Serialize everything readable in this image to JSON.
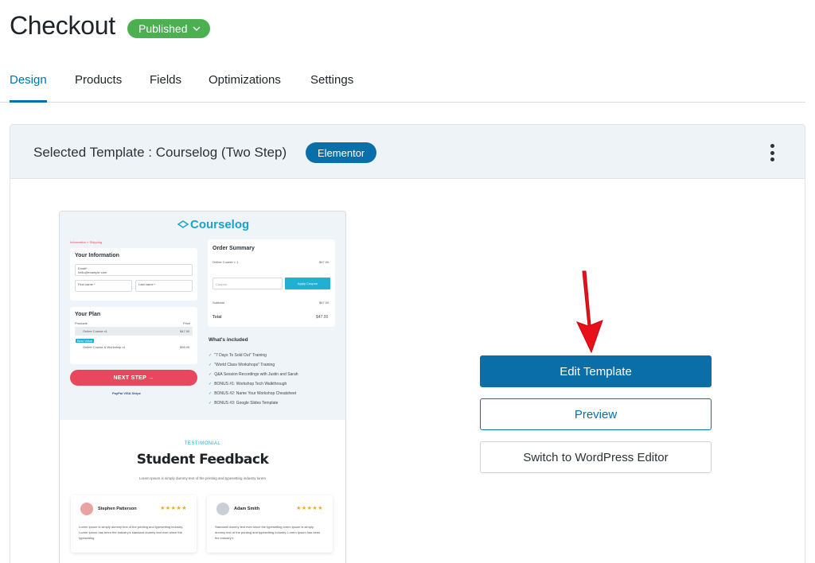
{
  "page": {
    "title": "Checkout",
    "status": "Published"
  },
  "tabs": [
    {
      "label": "Design",
      "active": true
    },
    {
      "label": "Products",
      "active": false
    },
    {
      "label": "Fields",
      "active": false
    },
    {
      "label": "Optimizations",
      "active": false
    },
    {
      "label": "Settings",
      "active": false
    }
  ],
  "template": {
    "selected_label": "Selected Template :  Courselog  (Two Step)",
    "builder": "Elementor",
    "more_menu_icon": "more-vertical-icon"
  },
  "preview": {
    "logo": "Courselog",
    "breadcrumb": "Information  »  Shipping",
    "your_information": "Your Information",
    "email_label": "Email*",
    "email_value": "hello@example.com",
    "first_name_label": "First name *",
    "last_name_label": "Last name *",
    "your_plan": "Your Plan",
    "plan_col_product": "Products",
    "plan_col_price": "Price",
    "plan_item_1": "Online Course x1",
    "plan_item_1_price": "$47.00",
    "plan_badge": "Best Value",
    "plan_item_2": "Online Course & Workshop x1",
    "plan_item_2_price": "$98.00",
    "next_step": "NEXT STEP →",
    "payment_methods": "PayPal  VISA  Stripe",
    "order_summary": "Order Summary",
    "order_item": "Online Course × 1",
    "order_item_price": "$47.00",
    "coupon_placeholder": "Coupon",
    "apply_coupon": "Apply Coupon",
    "subtotal_label": "Subtotal",
    "subtotal_value": "$47.00",
    "total_label": "Total",
    "total_value": "$47.00",
    "whats_included": "What's included",
    "included": [
      "\"7 Days To Sold Out\" Training",
      "\"World Class Workshops\" Training",
      "Q&A Session Recordings with Justin and Sarah",
      "BONUS #1: Workshop Tech Walkthrough",
      "BONUS #2: Name Your Workshop Cheatsheet",
      "BONUS #3: Google Slides Template"
    ],
    "testimonial_eyebrow": "TESTIMONIAL",
    "feedback_title": "Student Feedback",
    "feedback_sub": "Lorem Ipsum is simply dummy text of the printing and typesetting industry lorem",
    "reviews": [
      {
        "name": "Stephen Patterson",
        "stars": "★★★★★",
        "text": "Lorem Ipsum is simply dummy text of the printing and typesetting industry. Lorem Ipsum has been the industry's standard dummy text ever since the typesetting"
      },
      {
        "name": "Adam Smith",
        "stars": "★★★★★",
        "text": "Standard dummy text ever since the typesetting lorem ipsum is simply dummy text of the printing and typesetting industry. Lorem Ipsum has been the industry's"
      }
    ]
  },
  "actions": {
    "edit": "Edit Template",
    "preview": "Preview",
    "switch": "Switch to WordPress Editor"
  },
  "colors": {
    "accent": "#0a6ea8",
    "published": "#4caf50",
    "arrow": "#e8101a",
    "next_step": "#e8475e"
  }
}
